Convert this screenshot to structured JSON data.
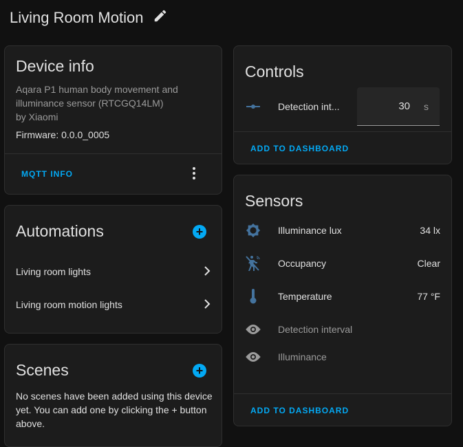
{
  "page": {
    "title": "Living Room Motion"
  },
  "device_info": {
    "title": "Device info",
    "description": "Aqara P1 human body movement and illuminance sensor (RTCGQ14LM)",
    "by": "by Xiaomi",
    "firmware": "Firmware: 0.0.0_0005",
    "mqtt_label": "MQTT INFO"
  },
  "automations": {
    "title": "Automations",
    "items": [
      {
        "label": "Living room lights"
      },
      {
        "label": "Living room motion lights"
      }
    ]
  },
  "scenes": {
    "title": "Scenes",
    "empty_text": "No scenes have been added using this device yet. You can add one by clicking the + button above."
  },
  "controls": {
    "title": "Controls",
    "items": [
      {
        "label": "Detection int...",
        "value": "30",
        "unit": "s"
      }
    ],
    "add_label": "ADD TO DASHBOARD"
  },
  "sensors": {
    "title": "Sensors",
    "items": [
      {
        "label": "Illuminance lux",
        "value": "34 lx"
      },
      {
        "label": "Occupancy",
        "value": "Clear"
      },
      {
        "label": "Temperature",
        "value": "77 °F"
      }
    ],
    "hidden": [
      {
        "label": "Detection interval"
      },
      {
        "label": "Illuminance"
      }
    ],
    "add_label": "ADD TO DASHBOARD"
  },
  "colors": {
    "accent": "#03a9f4",
    "icon": "#44739e",
    "card": "#1c1c1c",
    "background": "#111111"
  }
}
